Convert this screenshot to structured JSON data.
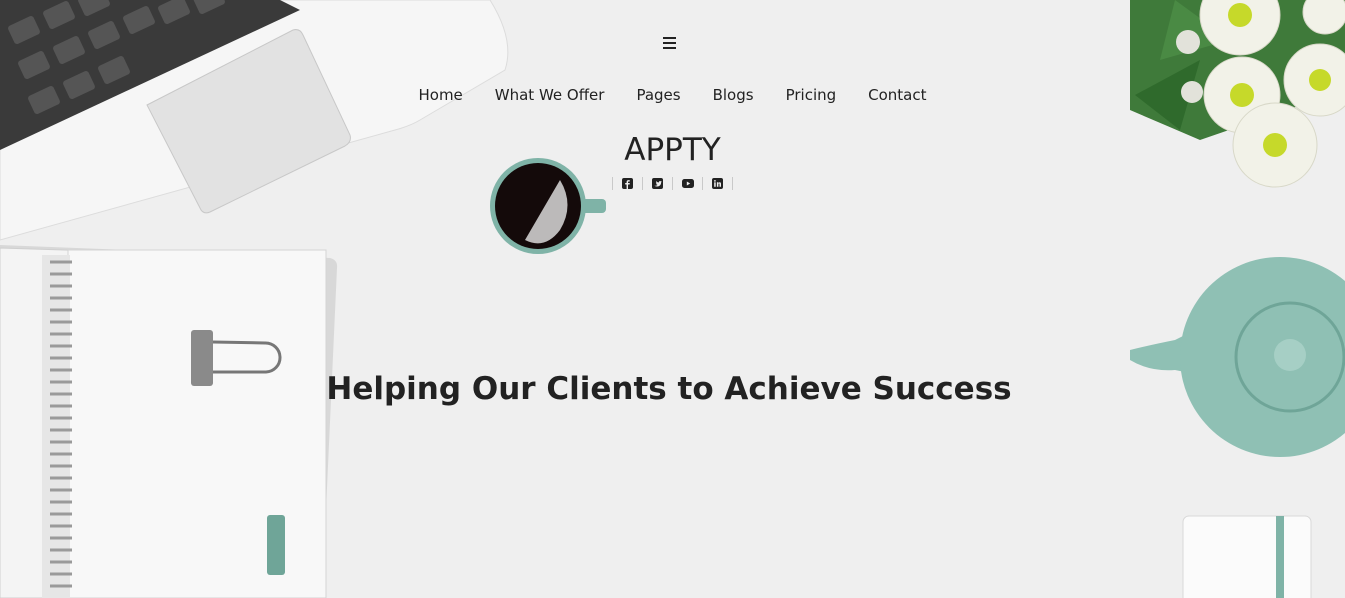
{
  "header": {
    "menu_icon": "hamburger-icon",
    "nav": [
      "Home",
      "What We Offer",
      "Pages",
      "Blogs",
      "Pricing",
      "Contact"
    ]
  },
  "brand": {
    "name": "APPTY"
  },
  "social": [
    "facebook-icon",
    "twitter-icon",
    "youtube-icon",
    "linkedin-icon"
  ],
  "hero": {
    "headline": "Helping Our Clients to Achieve Success"
  },
  "colors": {
    "background": "#efefef",
    "accent": "#7fb3a7",
    "text": "#222222"
  }
}
